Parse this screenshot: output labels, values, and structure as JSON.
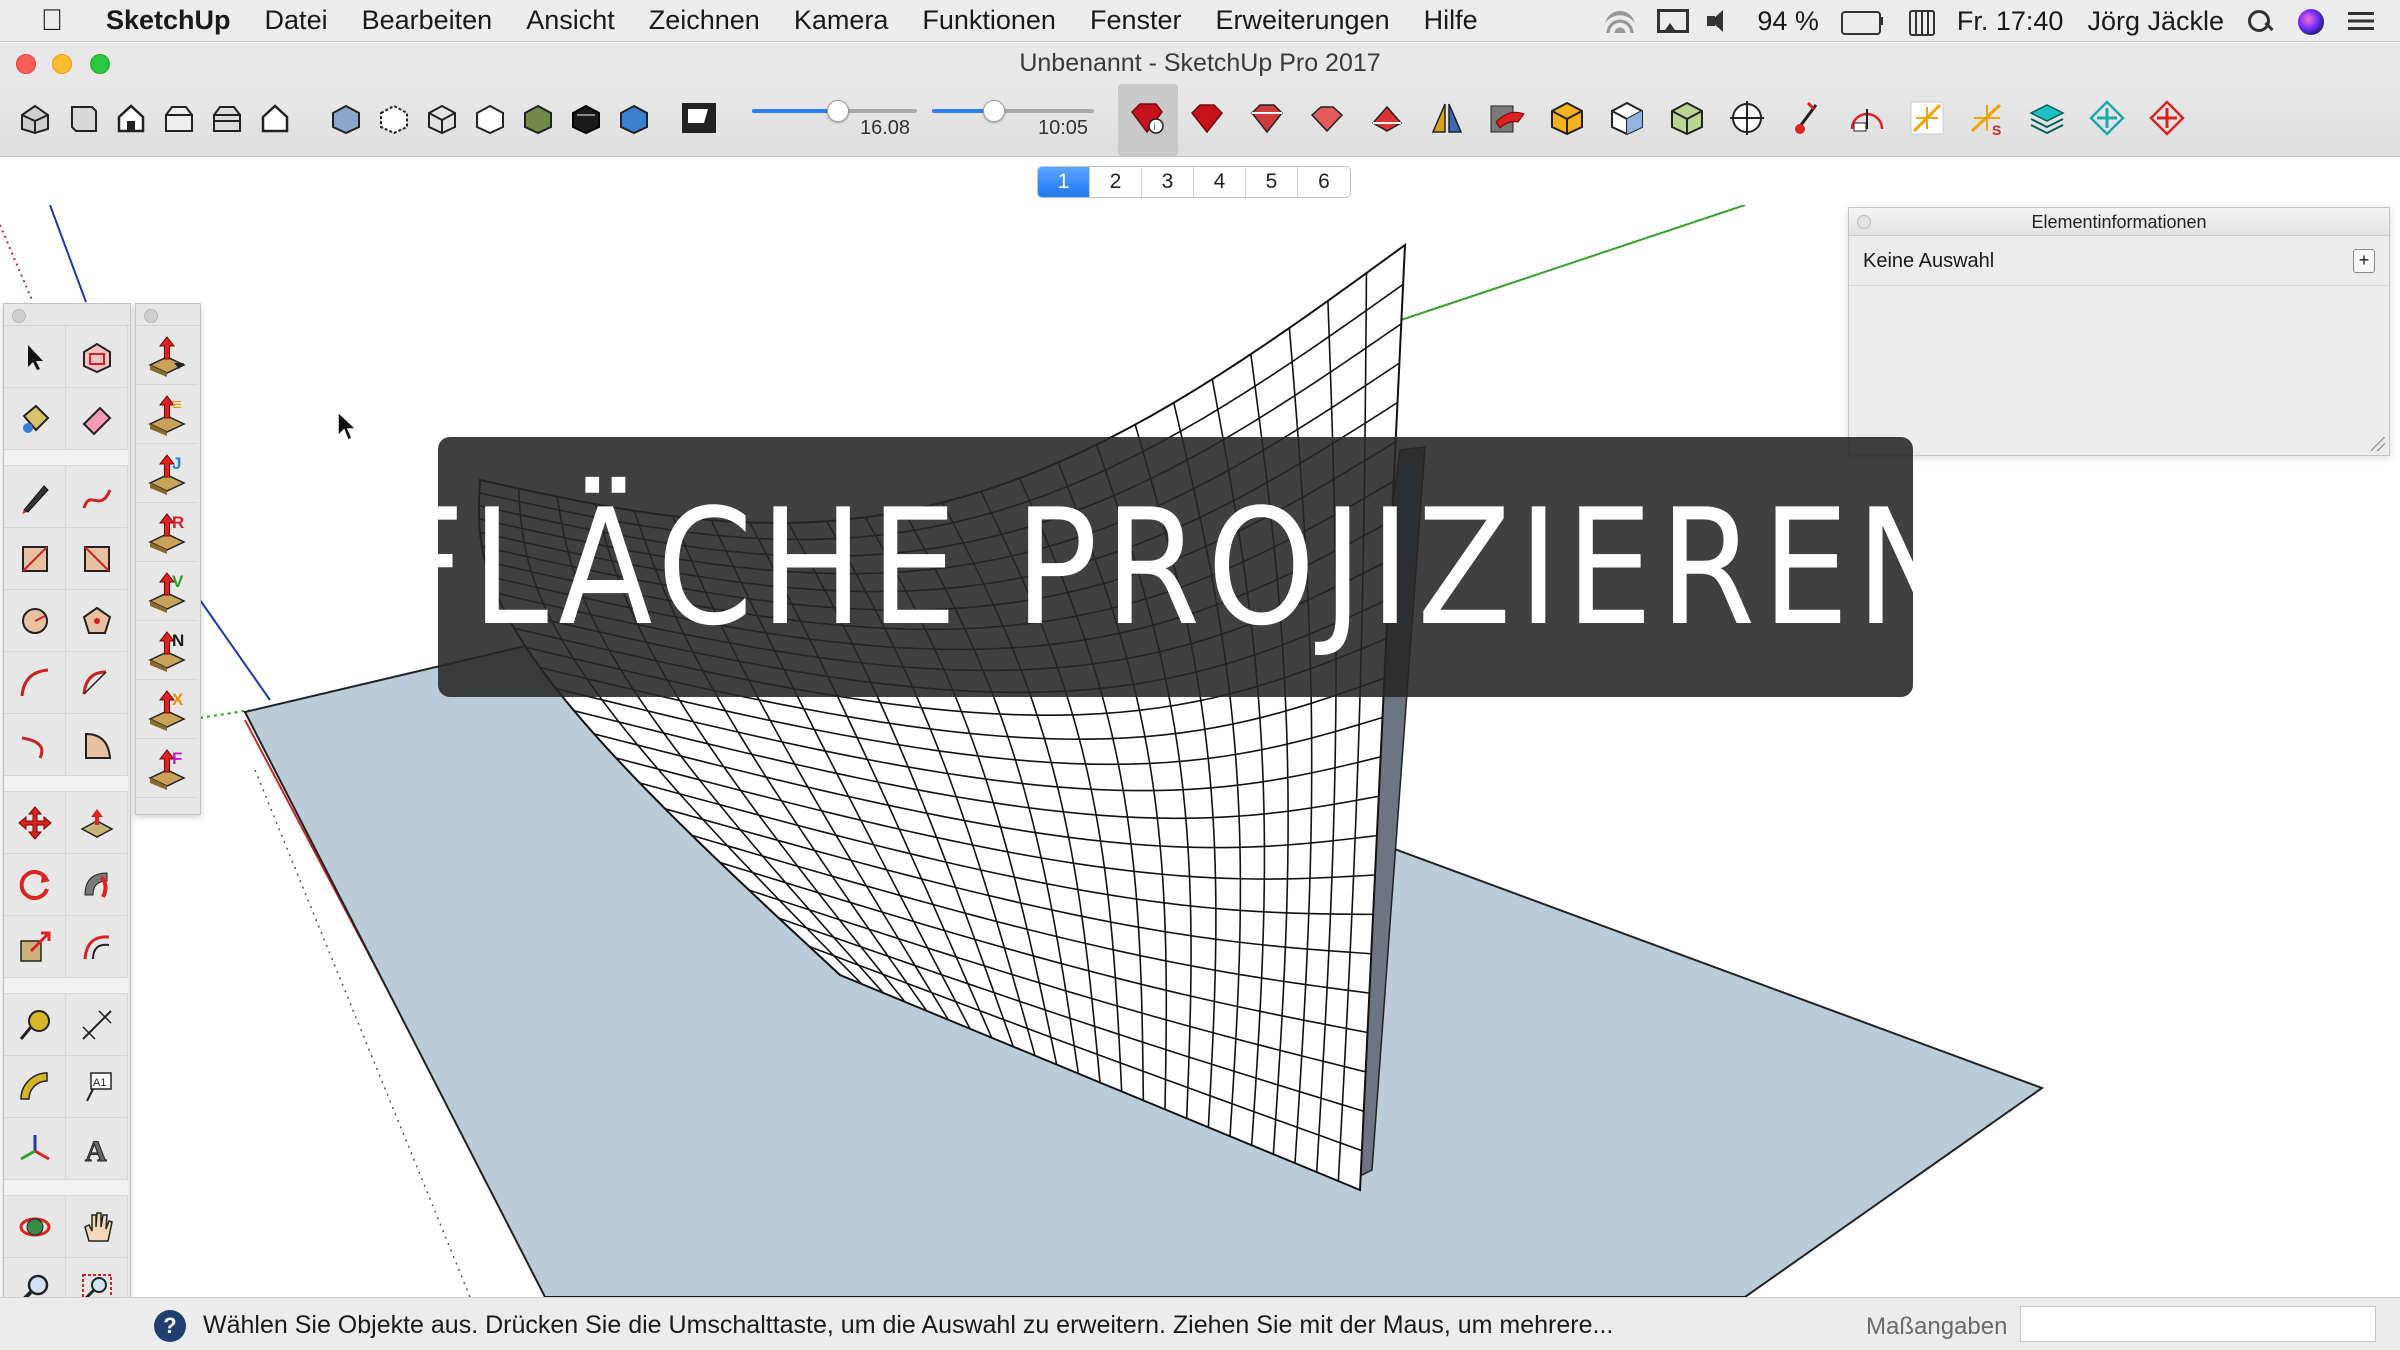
{
  "menubar": {
    "apple_icon": "apple-logo",
    "app_name": "SketchUp",
    "items": [
      "Datei",
      "Bearbeiten",
      "Ansicht",
      "Zeichnen",
      "Kamera",
      "Funktionen",
      "Fenster",
      "Erweiterungen",
      "Hilfe"
    ],
    "battery_percent": "94 %",
    "clock": "Fr. 17:40",
    "user": "Jörg Jäckle"
  },
  "window": {
    "title": "Unbenannt - SketchUp Pro 2017"
  },
  "toolbar": {
    "shadow_date_value": "16.08",
    "shadow_time_value": "10:05",
    "shadow_date_fraction": 0.52,
    "shadow_time_fraction": 0.38
  },
  "scene_tabs": [
    "1",
    "2",
    "3",
    "4",
    "5",
    "6"
  ],
  "active_scene": "1",
  "entity_info": {
    "title": "Elementinformationen",
    "selection": "Keine Auswahl",
    "expand_symbol": "+"
  },
  "overlay": {
    "title": "FLÄCHE PROJIZIEREN"
  },
  "sandbox_tools": [
    {
      "letter": "",
      "color": "#555555"
    },
    {
      "letter": "≡",
      "color": "#e0a000"
    },
    {
      "letter": "J",
      "color": "#2a7de1"
    },
    {
      "letter": "R",
      "color": "#d42020"
    },
    {
      "letter": "V",
      "color": "#2aa02a"
    },
    {
      "letter": "N",
      "color": "#1a1a1a"
    },
    {
      "letter": "X",
      "color": "#f08c00"
    },
    {
      "letter": "F",
      "color": "#c020c0"
    }
  ],
  "status": {
    "help_symbol": "?",
    "text": "Wählen Sie Objekte aus. Drücken Sie die Umschalttaste, um die Auswahl zu erweitern. Ziehen Sie mit der Maus, um mehrere...",
    "measure_label": "Maßangaben",
    "measure_value": ""
  },
  "colors": {
    "ground_plane": "#b9ccd8",
    "axis_red": "#c22b2b",
    "axis_green": "#33a02c",
    "axis_blue": "#1f3aa8",
    "accent_blue": "#1c79f2",
    "overlay_bg": "#262626"
  }
}
